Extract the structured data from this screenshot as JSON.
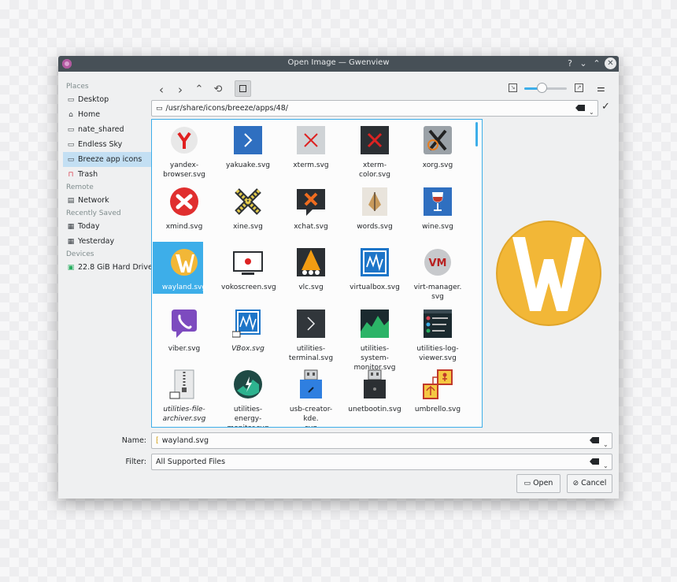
{
  "window": {
    "title": "Open Image — Gwenview",
    "controls": [
      "?",
      "⌄",
      "⌃"
    ]
  },
  "places": {
    "sections": [
      {
        "label": "Places",
        "items": [
          {
            "label": "Desktop",
            "icon": "desktop-icon"
          },
          {
            "label": "Home",
            "icon": "home-icon"
          },
          {
            "label": "nate_shared",
            "icon": "folder-icon"
          },
          {
            "label": "Endless Sky",
            "icon": "folder-icon"
          },
          {
            "label": "Breeze app icons",
            "icon": "folder-icon",
            "selected": true
          },
          {
            "label": "Trash",
            "icon": "trash-icon"
          }
        ]
      },
      {
        "label": "Remote",
        "items": [
          {
            "label": "Network",
            "icon": "network-icon"
          }
        ]
      },
      {
        "label": "Recently Saved",
        "items": [
          {
            "label": "Today",
            "icon": "calendar-icon"
          },
          {
            "label": "Yesterday",
            "icon": "calendar-icon"
          }
        ]
      },
      {
        "label": "Devices",
        "items": [
          {
            "label": "22.8 GiB Hard Drive",
            "icon": "hard-drive-icon"
          }
        ]
      }
    ]
  },
  "location": {
    "path": "/usr/share/icons/breeze/apps/48/"
  },
  "files": [
    {
      "label": "yandex-\nbrowser.svg",
      "icon": "yandex-icon"
    },
    {
      "label": "yakuake.svg",
      "icon": "yakuake-icon"
    },
    {
      "label": "xterm.svg",
      "icon": "xterm-icon"
    },
    {
      "label": "xterm-color.svg",
      "icon": "xterm-color-icon"
    },
    {
      "label": "xorg.svg",
      "icon": "xorg-icon"
    },
    {
      "label": "xmind.svg",
      "icon": "xmind-icon"
    },
    {
      "label": "xine.svg",
      "icon": "xine-icon"
    },
    {
      "label": "xchat.svg",
      "icon": "xchat-icon"
    },
    {
      "label": "words.svg",
      "icon": "words-icon"
    },
    {
      "label": "wine.svg",
      "icon": "wine-icon"
    },
    {
      "label": "wayland.svg",
      "icon": "wayland-icon",
      "selected": true
    },
    {
      "label": "vokoscreen.svg",
      "icon": "vokoscreen-icon"
    },
    {
      "label": "vlc.svg",
      "icon": "vlc-icon"
    },
    {
      "label": "virtualbox.svg",
      "icon": "virtualbox-icon"
    },
    {
      "label": "virt-manager.\nsvg",
      "icon": "virt-manager-icon"
    },
    {
      "label": "viber.svg",
      "icon": "viber-icon"
    },
    {
      "label": "VBox.svg",
      "icon": "vbox-icon",
      "italic": true
    },
    {
      "label": "utilities-\nterminal.svg",
      "icon": "terminal-icon"
    },
    {
      "label": "utilities-system-\nmonitor.svg",
      "icon": "system-monitor-icon"
    },
    {
      "label": "utilities-log-\nviewer.svg",
      "icon": "log-viewer-icon"
    },
    {
      "label": "utilities-file-\narchiver.svg",
      "icon": "file-archiver-icon",
      "italic": true
    },
    {
      "label": "utilities-energy-\nmonitor.svg",
      "icon": "energy-monitor-icon"
    },
    {
      "label": "usb-creator-kde.\nsvg",
      "icon": "usb-creator-icon"
    },
    {
      "label": "unetbootin.svg",
      "icon": "unetbootin-icon"
    },
    {
      "label": "umbrello.svg",
      "icon": "umbrello-icon"
    }
  ],
  "name_field": {
    "label": "Name:",
    "value": "wayland.svg"
  },
  "filter_field": {
    "label": "Filter:",
    "value": "All Supported Files"
  },
  "buttons": {
    "open": "Open",
    "cancel": "Cancel"
  },
  "colors": {
    "accent": "#3daee9",
    "titlebar": "#475057",
    "wayland": "#f2b737"
  }
}
